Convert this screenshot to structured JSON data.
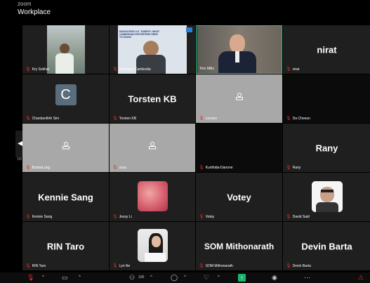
{
  "window": {
    "app_small": "zoom",
    "title": "Workplace"
  },
  "pager": "1/5",
  "tiles": [
    {
      "name": "Kry Sokhai",
      "display": ""
    },
    {
      "name": "AmCham Cambodia",
      "display": "",
      "slide_text": "NAVIGATING U.S. TARIFFS: WHAT CAMBODIAN EXPORTERS NEED TO KNOW"
    },
    {
      "name": "Tom Mills",
      "display": ""
    },
    {
      "name": "nirat",
      "display": "nirat"
    },
    {
      "name": "Chanbunthth Sim",
      "display": "",
      "avatar_letter": "C"
    },
    {
      "name": "Torsten KB",
      "display": "Torsten KB"
    },
    {
      "name": "Lenovo",
      "display": ""
    },
    {
      "name": "Da Choeun",
      "display": ""
    },
    {
      "name": "BunnaLong",
      "display": ""
    },
    {
      "name": "sosu",
      "display": ""
    },
    {
      "name": "Kunthida-Danone",
      "display": ""
    },
    {
      "name": "Rany",
      "display": "Rany"
    },
    {
      "name": "Kennie Sang",
      "display": "Kennie Sang"
    },
    {
      "name": "Jessy Li",
      "display": ""
    },
    {
      "name": "Votey",
      "display": "Votey"
    },
    {
      "name": "David Said",
      "display": ""
    },
    {
      "name": "RIN Taro",
      "display": "RIN Taro"
    },
    {
      "name": "Lyn Ne",
      "display": ""
    },
    {
      "name": "SOM Mithonarath",
      "display": "SOM Mithonarath"
    },
    {
      "name": "Devin Barta",
      "display": "Devin Barta"
    }
  ],
  "toolbar": {
    "participants_count": "100"
  },
  "colors": {
    "active_speaker": "#22c37a",
    "muted_mic": "#e0312b",
    "share_green": "#1bb36b"
  }
}
